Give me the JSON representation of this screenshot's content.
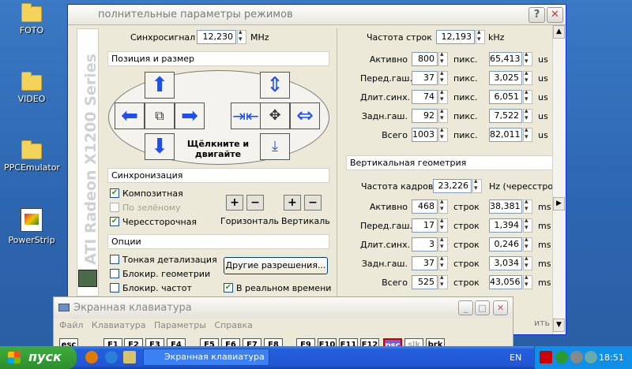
{
  "desktop": {
    "icons": [
      "FOTO",
      "VIDEO",
      "PPCEmulator",
      "PowerStrip"
    ]
  },
  "window": {
    "title": "полнительные параметры режимов",
    "help_btn": "?",
    "close_btn": "✕",
    "vertical_label": "ATI Radeon X1200 Series",
    "sync": {
      "label": "Синхросигнал",
      "value": "12,230",
      "unit": "MHz"
    },
    "position_group": "Позиция и размер",
    "dblclick_hint_line1": "Щёлкните и",
    "dblclick_hint_line2": "двигайте",
    "sync_group": "Синхронизация",
    "composite": "Композитная",
    "green": "По зелёному",
    "interlaced": "Черессторочная",
    "horiz": "Горизонталь",
    "vert": "Вертикаль",
    "options_group": "Опции",
    "fine": "Тонкая детализация",
    "lock_geom": "Блокир. геометрии",
    "lock_freq": "Блокир. частот",
    "other_res_btn": "Другие разрешения...",
    "realtime": "В реальном времени",
    "line_freq": {
      "label": "Частота строк",
      "value": "12,193",
      "unit": "kHz"
    },
    "horizontal_rows": [
      {
        "label": "Активно",
        "value": "800",
        "unit": "пикс.",
        "time": "65,413",
        "tunit": "us"
      },
      {
        "label": "Перед.гаш.",
        "value": "37",
        "unit": "пикс.",
        "time": "3,025",
        "tunit": "us"
      },
      {
        "label": "Длит.синх.",
        "value": "74",
        "unit": "пикс.",
        "time": "6,051",
        "tunit": "us"
      },
      {
        "label": "Задн.гаш.",
        "value": "92",
        "unit": "пикс.",
        "time": "7,522",
        "tunit": "us"
      },
      {
        "label": "Всего",
        "value": "1003",
        "unit": "пикс.",
        "time": "82,011",
        "tunit": "us"
      }
    ],
    "vert_group": "Вертикальная геометрия",
    "frame_freq": {
      "label": "Частота кадров",
      "value": "23,226",
      "unit": "Hz (чересстроч"
    },
    "vertical_rows": [
      {
        "label": "Активно",
        "value": "468",
        "unit": "строк",
        "time": "38,381",
        "tunit": "ms"
      },
      {
        "label": "Перед.гаш.",
        "value": "17",
        "unit": "строк",
        "time": "1,394",
        "tunit": "ms"
      },
      {
        "label": "Длит.синх.",
        "value": "3",
        "unit": "строк",
        "time": "0,246",
        "tunit": "ms"
      },
      {
        "label": "Задн.гаш.",
        "value": "37",
        "unit": "строк",
        "time": "3,034",
        "tunit": "ms"
      },
      {
        "label": "Всего",
        "value": "525",
        "unit": "строк",
        "time": "43,056",
        "tunit": "ms"
      }
    ],
    "hidden_text": "ить"
  },
  "keyboard": {
    "title": "Экранная клавиатура",
    "menu": [
      "Файл",
      "Клавиатура",
      "Параметры",
      "Справка"
    ],
    "keys": [
      "esc",
      "F1",
      "F2",
      "F3",
      "F4",
      "F5",
      "F6",
      "F7",
      "F8",
      "F9",
      "F10",
      "F11",
      "F12",
      "psc",
      "slk",
      "brk"
    ]
  },
  "taskbar": {
    "start": "пуск",
    "item": "Экранная клавиатура",
    "lang": "EN",
    "clock": "18:51"
  }
}
